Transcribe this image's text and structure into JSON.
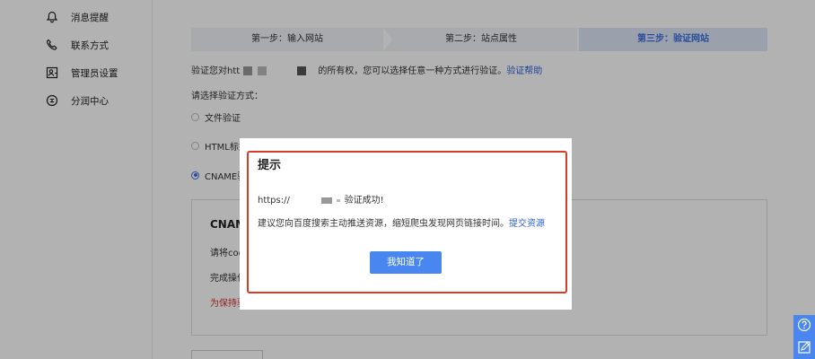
{
  "sidebar": {
    "items": [
      {
        "label": "消息提醒",
        "icon": "bell-icon"
      },
      {
        "label": "联系方式",
        "icon": "phone-icon"
      },
      {
        "label": "管理员设置",
        "icon": "admin-user-icon"
      },
      {
        "label": "分润中心",
        "icon": "profit-share-icon"
      }
    ]
  },
  "steps": [
    {
      "label": "第一步：输入网站"
    },
    {
      "label": "第二步：站点属性"
    },
    {
      "label": "第三步：验证网站",
      "active": true
    }
  ],
  "verify": {
    "prefix": "验证您对htt",
    "suffix": "的所有权，您可以选择任意一种方式进行验证。",
    "help_link": "验证帮助"
  },
  "choose_label": "请选择验证方式：",
  "methods": [
    {
      "label": "文件验证",
      "checked": false
    },
    {
      "label": "HTML标签",
      "checked": false
    },
    {
      "label": "CNAME验",
      "checked": true
    }
  ],
  "cname_panel": {
    "title": "CNAME",
    "line1": "请将cod",
    "line2": "完成操作",
    "line3": "为保持验"
  },
  "dialog": {
    "title": "提示",
    "url_prefix": "https://",
    "url_suffix": "验证成功!",
    "message": "建议您向百度搜索主动推送资源，缩短爬虫发现网页链接时间。",
    "message_link": "提交资源",
    "ok_button": "我知道了",
    "frame_color": "#d93b2b"
  },
  "float": {
    "items": [
      {
        "icon": "help-question-icon"
      },
      {
        "icon": "feedback-edit-icon"
      }
    ]
  },
  "colors": {
    "accent": "#3b6de0",
    "button": "#4a86f0",
    "warning_text": "#d0312d"
  }
}
